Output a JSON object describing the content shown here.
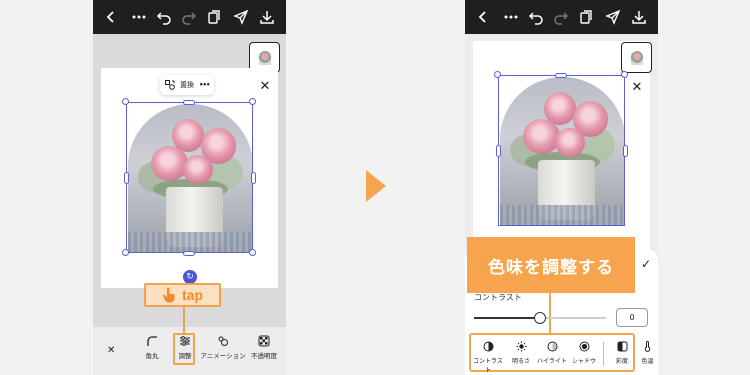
{
  "left_phone": {
    "float_toolbar": {
      "replace_label": "置換",
      "more_label": "•••"
    },
    "toolbar_items": [
      {
        "label": "角丸",
        "icon": "rounded-corner-icon"
      },
      {
        "label": "調整",
        "icon": "sliders-icon"
      },
      {
        "label": "アニメーション",
        "icon": "animation-icon"
      },
      {
        "label": "不透明度",
        "icon": "opacity-icon"
      }
    ]
  },
  "tap_callout": {
    "text": "tap"
  },
  "right_phone": {
    "callout": {
      "text": "色味を調整する"
    },
    "slider": {
      "label": "コントラスト",
      "value": "0",
      "position": 0.5
    },
    "adjust_tabs": [
      {
        "label": "コントラスト",
        "icon": "contrast-icon"
      },
      {
        "label": "明るさ",
        "icon": "brightness-icon"
      },
      {
        "label": "ハイライト",
        "icon": "highlight-icon"
      },
      {
        "label": "シャドウ",
        "icon": "shadow-icon"
      },
      {
        "label": "彩度",
        "icon": "saturation-icon"
      },
      {
        "label": "色温",
        "icon": "temperature-icon"
      }
    ]
  },
  "colors": {
    "accent_orange": "#f6a54e",
    "selection_blue": "#5a5fd6",
    "topbar": "#1f1f1f"
  }
}
